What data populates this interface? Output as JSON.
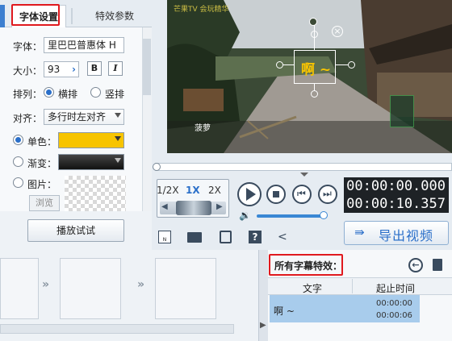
{
  "tabs": {
    "font_settings": "字体设置",
    "effect_params": "特效参数"
  },
  "font": {
    "font_label": "字体：",
    "font_value": "里巴巴普惠体 H",
    "size_label": "大小：",
    "size_value": "93",
    "bold": "B",
    "italic": "I",
    "layout_label": "排列：",
    "horizontal": "横排",
    "vertical": "竖排",
    "align_label": "对齐：",
    "align_value": "多行时左对齐",
    "solid_label": "单色：",
    "gradient_label": "渐变：",
    "image_label": "图片：",
    "browse": "浏览",
    "solid_color": "#f7c400",
    "gradient_color": "#111111"
  },
  "trial_button": "播放试试",
  "video": {
    "subtitle_text": "啊 ~",
    "watermark": "芒果TV 会玩精华",
    "caption": "菠萝"
  },
  "speed": {
    "half": "1/2X",
    "one": "1X",
    "two": "2X"
  },
  "time": {
    "current": "00:00:00.000",
    "total": "00:00:10.357"
  },
  "export_label": "导出视频",
  "effects": {
    "title": "所有字幕特效：",
    "col_text": "文字",
    "col_time": "起止时间",
    "row_text": "啊 ~",
    "row_start": "00:00:00",
    "row_end": "00:00:06"
  },
  "colors": {
    "accent": "#2a6fc9",
    "highlight_row": "#a8ccec",
    "red_box": "#e0191e"
  }
}
